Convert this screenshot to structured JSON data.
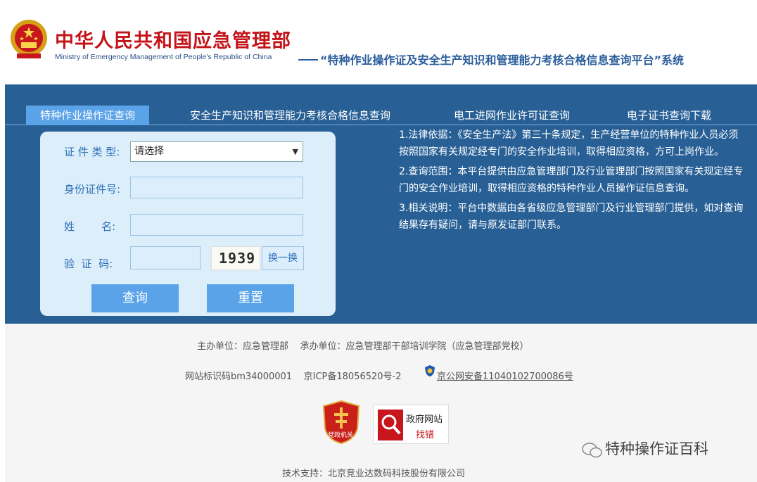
{
  "header": {
    "cn_title": "中华人民共和国应急管理部",
    "en_title": "Ministry of Emergency Management of People's Republic of China",
    "system_title": "“特种作业操作证及安全生产知识和管理能力考核合格信息查询平台”系统"
  },
  "tabs": [
    {
      "label": "特种作业操作证查询",
      "active": true
    },
    {
      "label": "安全生产知识和管理能力考核合格信息查询",
      "active": false
    },
    {
      "label": "电工进网作业许可证查询",
      "active": false
    },
    {
      "label": "电子证书查询下载",
      "active": false
    }
  ],
  "form": {
    "cert_type_label": "证 件 类 型:",
    "cert_type_value": "请选择",
    "id_label": "身份证件号:",
    "id_value": "",
    "name_label": "姓        名:",
    "name_value": "",
    "captcha_label": "验  证  码:",
    "captcha_value": "",
    "captcha_text": "1939",
    "refresh_label": "换一换",
    "query_label": "查询",
    "reset_label": "重置"
  },
  "info": [
    "1.法律依据：《安全生产法》第三十条规定，生产经营单位的特种作业人员必须按照国家有关规定经专门的安全作业培训，取得相应资格，方可上岗作业。",
    "2.查询范围：本平台提供由应急管理部门及行业管理部门按照国家有关规定经专门的安全作业培训，取得相应资格的特种作业人员操作证信息查询。",
    "3.相关说明：平台中数据由各省级应急管理部门及行业管理部门提供，如对查询结果存有疑问，请与原发证部门联系。"
  ],
  "footer": {
    "sponsor": "主办单位：应急管理部    承办单位：应急管理部干部培训学院（应急管理部党校）",
    "site_id": "网站标识码bm34000001    京ICP备18056520号-2",
    "police": "京公网安备11040102700086号",
    "party_badge": "党政机关",
    "gov_error_line1": "政府网站",
    "gov_error_line2": "找错",
    "wechat": "特种操作证百科",
    "tech_support": "技术支持：北京竞业达数码科技股份有限公司"
  },
  "colors": {
    "band": "#286096",
    "tab_active": "#5aa3e8",
    "title_red": "#c4141a",
    "system_blue": "#2a5d9c"
  }
}
